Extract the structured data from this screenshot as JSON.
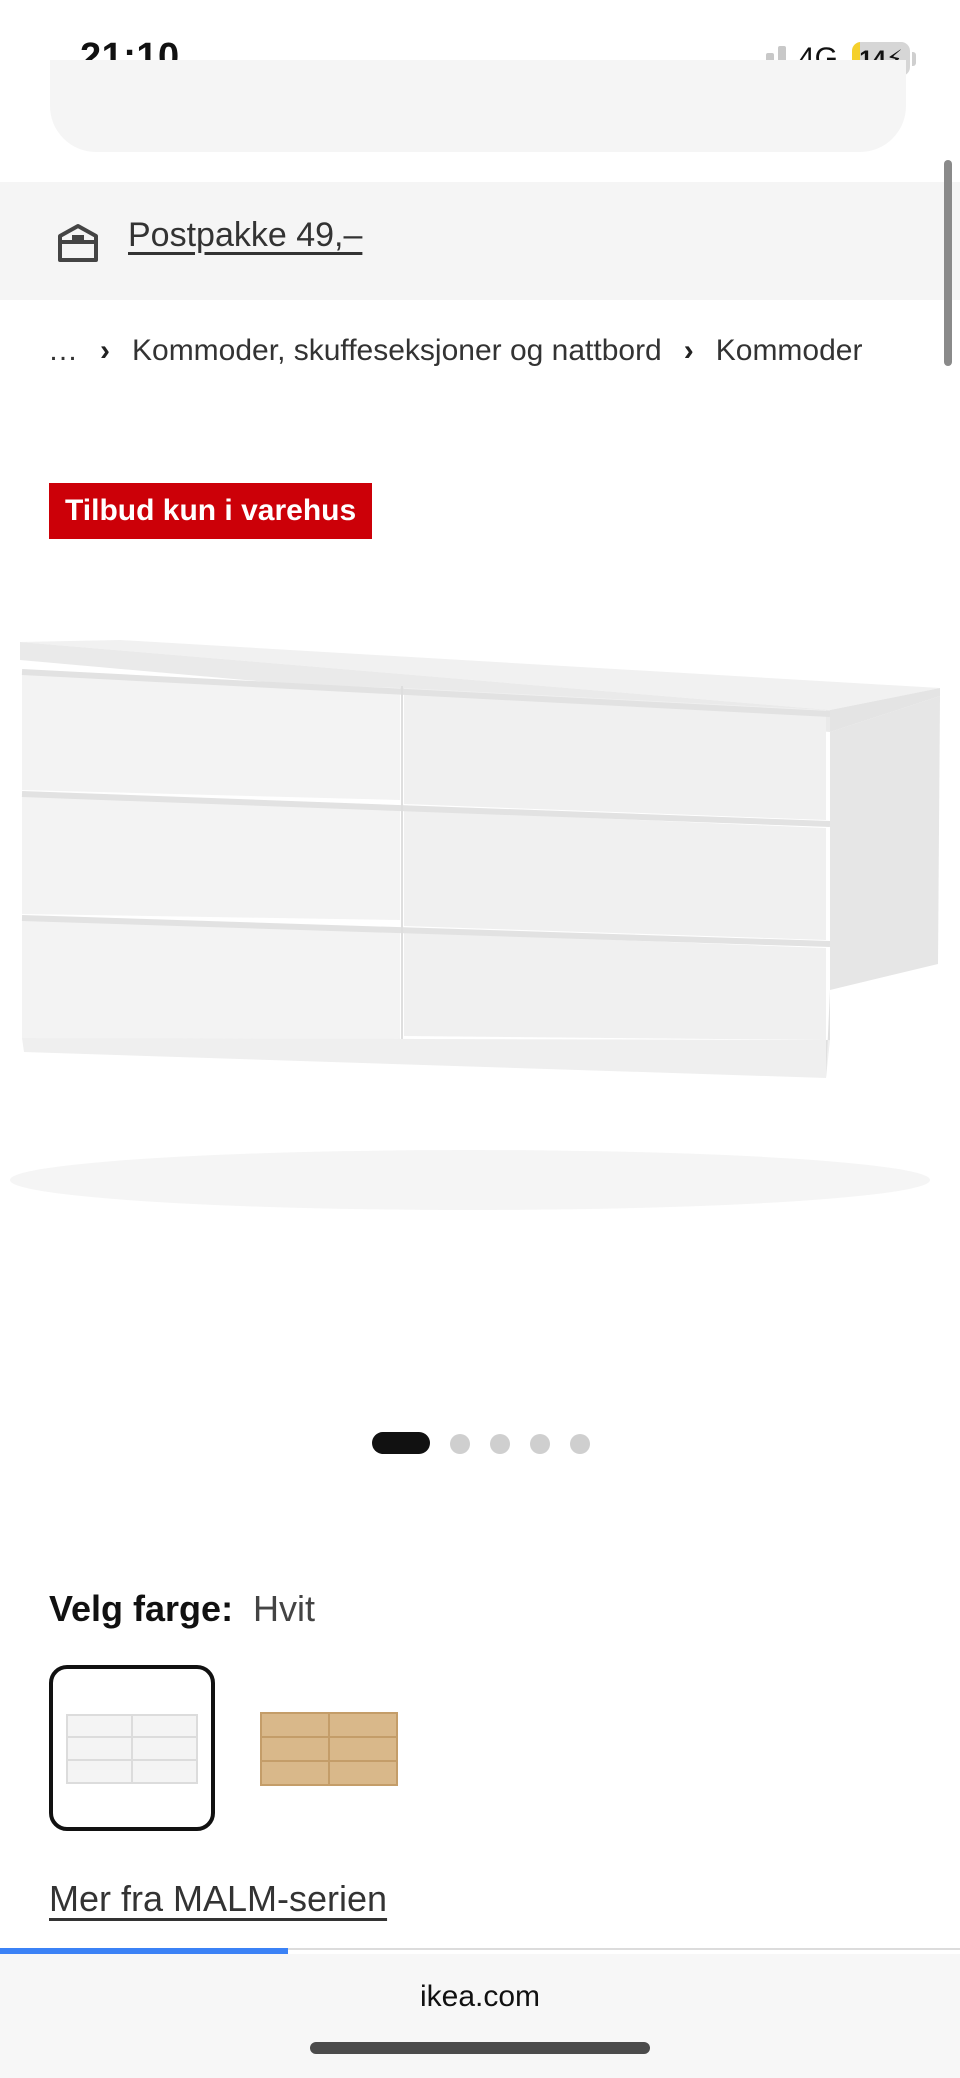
{
  "status_bar": {
    "time": "21:10",
    "network": "4G",
    "battery_percent": "14",
    "battery_level": 0.14,
    "signal_bars_active": 2,
    "icons": [
      "signal-icon",
      "battery-charging-icon"
    ]
  },
  "delivery": {
    "icon": "box-icon",
    "text": "Postpakke 49,–"
  },
  "breadcrumb": {
    "items": [
      "…",
      "Kommoder, skuffeseksjoner og nattbord",
      "Kommoder"
    ],
    "separator": "›"
  },
  "badge": {
    "text": "Tilbud kun i varehus",
    "color": "#cc0008"
  },
  "carousel": {
    "total": 5,
    "active_index": 0
  },
  "color_selector": {
    "label": "Velg farge:",
    "selected": "Hvit",
    "options": [
      {
        "name": "white",
        "selected": true,
        "color": "#f2f2f2"
      },
      {
        "name": "oak",
        "selected": false,
        "color": "#d9b88a"
      }
    ]
  },
  "series_link": "Mer fra MALM-serien",
  "browser": {
    "url": "ikea.com",
    "load_progress": 0.3,
    "accent": "#3b82f6"
  }
}
